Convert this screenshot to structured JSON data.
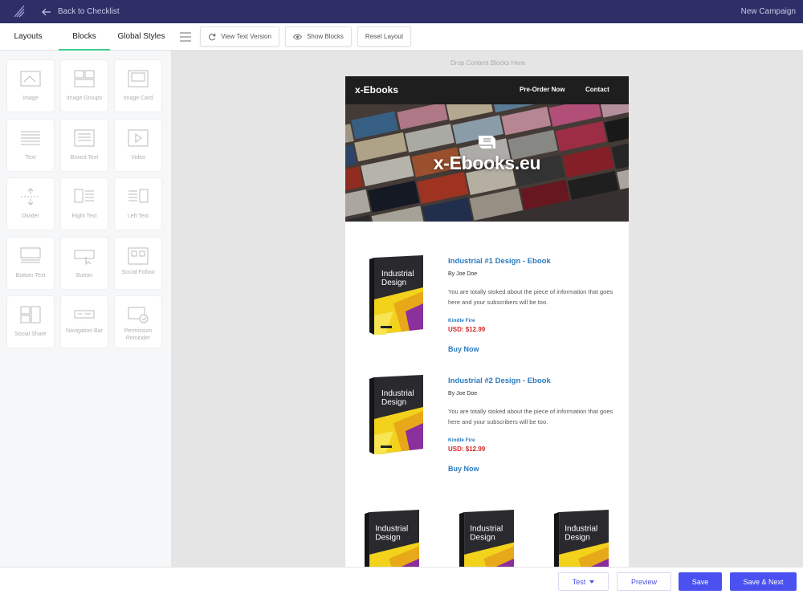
{
  "topbar": {
    "back_label": "Back to Checklist",
    "campaign_label": "New Campaign"
  },
  "tabs": [
    {
      "label": "Layouts"
    },
    {
      "label": "Blocks"
    },
    {
      "label": "Global Styles"
    }
  ],
  "toolbar": {
    "view_text": "View Text Version",
    "show_blocks": "Show Blocks",
    "reset_layout": "Reset Layout"
  },
  "blocks": [
    {
      "label": "Image",
      "icon": "image-icon"
    },
    {
      "label": "Image Groups",
      "icon": "image-groups-icon"
    },
    {
      "label": "Image Card",
      "icon": "image-card-icon"
    },
    {
      "label": "Text",
      "icon": "text-icon"
    },
    {
      "label": "Boxed Text",
      "icon": "boxed-text-icon"
    },
    {
      "label": "Video",
      "icon": "video-icon"
    },
    {
      "label": "Divider",
      "icon": "divider-icon"
    },
    {
      "label": "Right Text",
      "icon": "right-text-icon"
    },
    {
      "label": "Left Text",
      "icon": "left-text-icon"
    },
    {
      "label": "Bottom Text",
      "icon": "bottom-text-icon"
    },
    {
      "label": "Button",
      "icon": "button-icon"
    },
    {
      "label": "Social Follow",
      "icon": "social-follow-icon"
    },
    {
      "label": "Social Share",
      "icon": "social-share-icon"
    },
    {
      "label": "Navigation Bar",
      "icon": "navigation-bar-icon"
    },
    {
      "label": "Permission Reminder",
      "icon": "permission-reminder-icon"
    }
  ],
  "canvas": {
    "drop_hint": "Drop Content Blocks Here"
  },
  "email": {
    "brand": "x-Ebooks",
    "nav": [
      {
        "label": "Pre-Order Now"
      },
      {
        "label": "Contact"
      }
    ],
    "hero_title": "x-Ebooks.eu",
    "cover": {
      "line1": "Industrial",
      "line2": "Design"
    },
    "products": [
      {
        "title": "Industrial #1 Design - Ebook",
        "author": "By Joe Doe",
        "description": "You are totally stoked about the piece of information that goes here and your subscribers will be too.",
        "platform": "Kindle Fire",
        "price": "USD: $12.99",
        "cta": "Buy Now"
      },
      {
        "title": "Industrial #2 Design - Ebook",
        "author": "By Joe Doe",
        "description": "You are totally stoked about the piece of information that goes here and your subscribers will be too.",
        "platform": "Kindle Fire",
        "price": "USD: $12.99",
        "cta": "Buy Now"
      }
    ]
  },
  "footer": {
    "test": "Test",
    "preview": "Preview",
    "save": "Save",
    "save_next": "Save & Next"
  },
  "colors": {
    "topbar": "#2d2f66",
    "accent": "#3ecf8e",
    "primary": "#4a51f0",
    "link": "#2b7bbf",
    "price": "#cf2a2a"
  }
}
